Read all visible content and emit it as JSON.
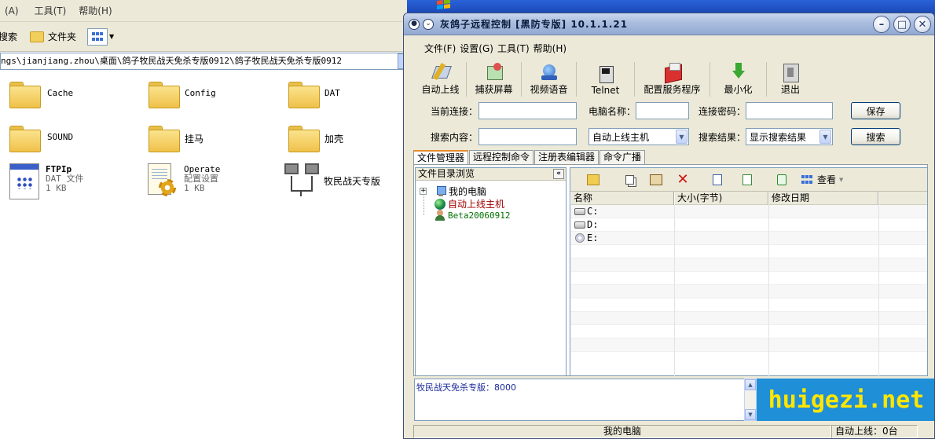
{
  "explorer": {
    "menu": [
      "(A)",
      "工具(T)",
      "帮助(H)"
    ],
    "toolbar": {
      "search": "搜索",
      "folders": "文件夹"
    },
    "address": "ngs\\jianjiang.zhou\\桌面\\鸽子牧民战天免杀专版0912\\鸽子牧民战天免杀专版0912",
    "files": [
      {
        "name": "Cache"
      },
      {
        "name": "Config"
      },
      {
        "name": "DAT"
      },
      {
        "name": "SOUND"
      },
      {
        "name": "挂马"
      },
      {
        "name": "加壳"
      },
      {
        "name": "FTPIp",
        "type": "DAT 文件",
        "size": "1 KB"
      },
      {
        "name": "Operate",
        "type": "配置设置",
        "size": "1 KB"
      },
      {
        "name": "牧民战天专版"
      }
    ]
  },
  "app": {
    "title": "灰鸽子远程控制 [黑防专版] 10.1.1.21",
    "menu": [
      "文件(F)",
      "设置(G)",
      "工具(T)",
      "帮助(H)"
    ],
    "toolbar": [
      {
        "label": "自动上线",
        "icon": "auto-online-icon"
      },
      {
        "label": "捕获屏幕",
        "icon": "capture-screen-icon"
      },
      {
        "label": "视频语音",
        "icon": "video-voice-icon"
      },
      {
        "label": "Telnet",
        "icon": "telnet-icon"
      },
      {
        "label": "配置服务程序",
        "icon": "config-service-icon"
      },
      {
        "label": "最小化",
        "icon": "minimize-arrow-icon"
      },
      {
        "label": "退出",
        "icon": "exit-icon"
      }
    ],
    "conn": {
      "current_label": "当前连接：",
      "pcname_label": "电脑名称：",
      "password_label": "连接密码：",
      "save_button": "保存",
      "current_value": "",
      "pcname_value": "",
      "password_value": ""
    },
    "search": {
      "content_label": "搜索内容：",
      "content_value": "",
      "scope_value": "自动上线主机",
      "result_label": "搜索结果：",
      "result_value": "显示搜索结果",
      "search_button": "搜索"
    },
    "tabs": [
      "文件管理器",
      "远程控制命令",
      "注册表编辑器",
      "命令广播"
    ],
    "tree": {
      "header": "文件目录浏览",
      "collapse": "«",
      "nodes": [
        {
          "label": "我的电脑",
          "color": "#000000"
        },
        {
          "label": "自动上线主机",
          "color": "#a00000"
        },
        {
          "label": "Beta20060912",
          "color": "#007000"
        }
      ]
    },
    "file_tools": {
      "view_label": "查看"
    },
    "columns": [
      "名称",
      "大小(字节)",
      "修改日期"
    ],
    "drives": [
      "C:",
      "D:",
      "E:"
    ],
    "log_text": "牧民战天免杀专版：8000",
    "banner": "huigezi.net",
    "status": {
      "left": "我的电脑",
      "right": "自动上线：0台"
    }
  }
}
